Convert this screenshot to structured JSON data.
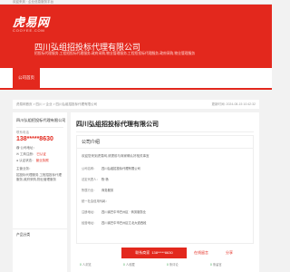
{
  "topbar": {
    "text": "欢迎来到 · 企业信息服务平台"
  },
  "header": {
    "logo_text": "虎易网",
    "logo_sub": "COOYEE.COM",
    "company_title": "四川弘组招投标代理有限公司",
    "business_lines": "招投标代理服务,工程招投标代理服务,政府采购,物业管理服务,工程招投标代理服务,政府采购,物业管理服务"
  },
  "nav": {
    "active_label": "公司首页"
  },
  "breadcrumb": {
    "path": "虎易网首页 > 四川 > 企业 > 四川弘组招投标代理有限公司",
    "updated": "更新时间: 2024-08-15 10:42:32"
  },
  "sidebar": {
    "company_name": "四川弘组招投标代理有限公司",
    "contact_label": "联系电话",
    "phone": "138*****8630",
    "rows": [
      {
        "icon": "phone-icon",
        "text": "公司地址："
      },
      {
        "icon": "mail-icon",
        "text": "工商注册：",
        "badge": "已认证"
      },
      {
        "icon": "user-icon",
        "text": "认证状态：",
        "badge": "营业执照"
      }
    ],
    "biz_label": "主营业务：",
    "biz_text": "招投标代理服务,工程招投标代理服务,政府采购,物业管理服务",
    "products_label": "产品分类"
  },
  "main": {
    "title": "四川弘组招投标代理有限公司",
    "intro_heading": "公司介绍",
    "intro_text": "欢迎您来到虎易网,请提前与商家确认好相关事宜",
    "info": [
      {
        "key": "公司名称：",
        "value": "四川弘组招投标代理有限公司"
      },
      {
        "key": "法定代表人：",
        "value": "陈·杨"
      },
      {
        "key": "所属行业：",
        "value": "商务服务"
      },
      {
        "key": "统一社会信用代码：",
        "value": "—"
      },
      {
        "key": "注册地址：",
        "value": "四川省巴中市巴州区 · 商务服务业"
      },
      {
        "key": "经营地址：",
        "value": "四川省巴中市巴州区江北大道西段"
      }
    ],
    "cta": {
      "phone_label": "联系商家",
      "phone": "138*****8630",
      "chip_1": "在线留言",
      "chip_2": "分享"
    },
    "stats": [
      {
        "value": "0",
        "label": "人浏览"
      },
      {
        "value": "0",
        "label": "人收藏"
      },
      {
        "value": "0",
        "label": "条评论"
      },
      {
        "value": "0",
        "label": "条留言"
      }
    ]
  }
}
